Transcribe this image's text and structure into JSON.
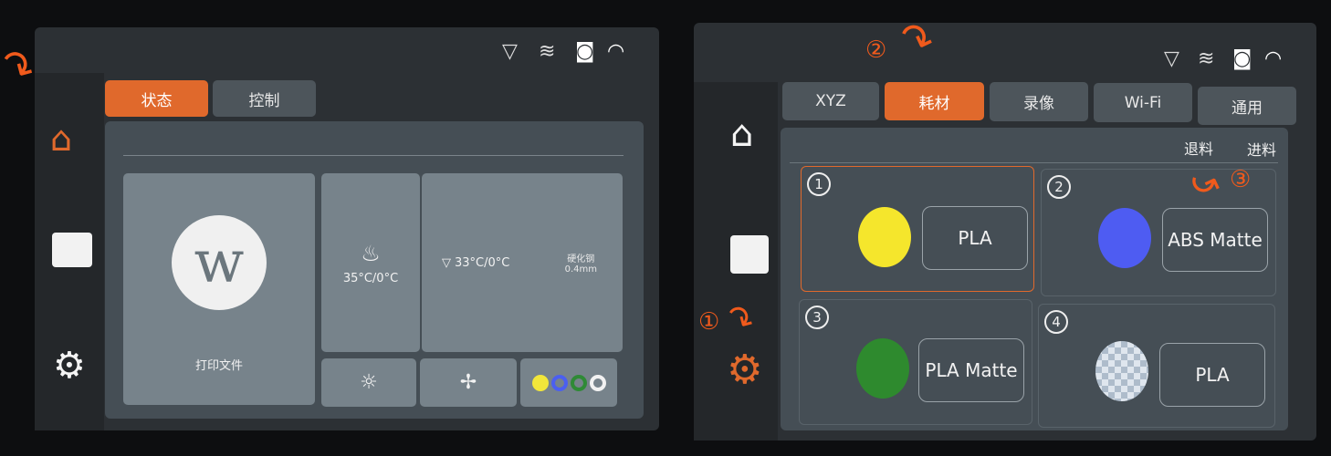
{
  "left_screen": {
    "tabs": [
      {
        "label": "状态",
        "active": true
      },
      {
        "label": "控制",
        "active": false
      }
    ],
    "print_card_label": "打印文件",
    "bed": {
      "temp": "35°C/0°C",
      "icon": "heated-bed-icon"
    },
    "nozzle": {
      "temp": "33°C/0°C",
      "type": "硬化钢",
      "size": "0.4mm",
      "icon": "nozzle-icon"
    },
    "filament_colors": [
      "#f2e63a",
      "#4b5ff0",
      "#2f8a36",
      "#f2f2f2"
    ],
    "sidebar": [
      {
        "icon": "home-icon",
        "active": true
      },
      {
        "icon": "folder-icon"
      },
      {
        "icon": "gear-icon"
      }
    ]
  },
  "right_screen": {
    "tabs": [
      {
        "label": "XYZ"
      },
      {
        "label": "耗材",
        "active": true
      },
      {
        "label": "录像"
      },
      {
        "label": "Wi-Fi"
      },
      {
        "label": "通用"
      }
    ],
    "unload_label": "退料",
    "load_label": "进料",
    "slots": [
      {
        "number": "1",
        "color": "#f5e62c",
        "material": "PLA",
        "selected": true
      },
      {
        "number": "2",
        "color": "#4e5cf2",
        "material": "ABS Matte"
      },
      {
        "number": "3",
        "color": "#2e8a2e",
        "material": "PLA Matte"
      },
      {
        "number": "4",
        "color": "transparent-checker",
        "material": "PLA"
      }
    ]
  },
  "annotations": {
    "step1": "①",
    "step2": "②",
    "step3": "③"
  },
  "colors": {
    "accent": "#e0692c",
    "annotation": "#f05a1c"
  }
}
